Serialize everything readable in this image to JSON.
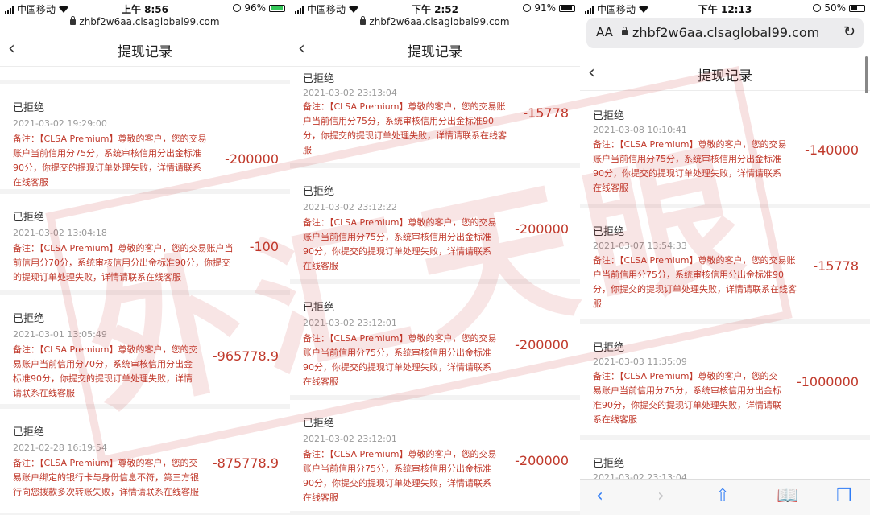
{
  "panels": [
    {
      "status": {
        "carrier": "中国移动",
        "time": "上午 8:56",
        "battery": "96%"
      },
      "url": "zhbf2w6aa.clsaglobal99.com",
      "title": "提现记录",
      "records": [
        {
          "status": "已拒绝",
          "date": "2021-03-02 19:29:00",
          "note": [
            "备注：【CLSA Premium】尊敬的客户，您的交易",
            "账户当前信用分75分，系统审核信用分出金标准",
            "90分，你提交的提现订单处理失败，详情请联系",
            "在线客服"
          ],
          "amount": "-200000"
        },
        {
          "status": "已拒绝",
          "date": "2021-03-02 13:04:18",
          "note": [
            "备注：【CLSA Premium】尊敬的客户，您的交易账户当",
            "前信用分70分，系统审核信用分出金标准90分，你提交",
            "的提现订单处理失败，详情请联系在线客服"
          ],
          "amount": "-100"
        },
        {
          "status": "已拒绝",
          "date": "2021-03-01 13:05:49",
          "note": [
            "备注：【CLSA Premium】尊敬的客户，您的交",
            "易账户当前信用分70分，系统审核信用分出金",
            "标准90分，你提交的提现订单处理失败，详情",
            "请联系在线客服"
          ],
          "amount": "-965778.9"
        },
        {
          "status": "已拒绝",
          "date": "2021-02-28 16:19:54",
          "note": [
            "备注：【CLSA Premium】尊敬的客户，您的交",
            "易账户绑定的银行卡与身份信息不符，第三方银",
            "行向您拨款多次转账失败，详情请联系在线客服"
          ],
          "amount": "-875778.9"
        }
      ]
    },
    {
      "status": {
        "carrier": "中国移动",
        "time": "下午 2:52",
        "battery": "91%"
      },
      "url": "zhbf2w6aa.clsaglobal99.com",
      "title": "提现记录",
      "records": [
        {
          "status": "已拒绝",
          "date": "2021-03-02 23:13:04",
          "note": [
            "备注：【CLSA Premium】尊敬的客户，您的交易账",
            "户当前信用分75分，系统审核信用分出金标准90",
            "分，你提交的提现订单处理失败，详情请联系在线客",
            "服"
          ],
          "amount": "-15778"
        },
        {
          "status": "已拒绝",
          "date": "2021-03-02 23:12:22",
          "note": [
            "备注：【CLSA Premium】尊敬的客户，您的交易",
            "账户当前信用分75分，系统审核信用分出金标准",
            "90分，你提交的提现订单处理失败，详情请联系",
            "在线客服"
          ],
          "amount": "-200000"
        },
        {
          "status": "已拒绝",
          "date": "2021-03-02 23:12:01",
          "note": [
            "备注：【CLSA Premium】尊敬的客户，您的交易",
            "账户当前信用分75分，系统审核信用分出金标准",
            "90分，你提交的提现订单处理失败，详情请联系",
            "在线客服"
          ],
          "amount": "-200000"
        },
        {
          "status": "已拒绝",
          "date": "2021-03-02 23:12:01",
          "note": [
            "备注：【CLSA Premium】尊敬的客户，您的交易",
            "账户当前信用分75分，系统审核信用分出金标准",
            "90分，你提交的提现订单处理失败，详情请联系",
            "在线客服"
          ],
          "amount": "-200000"
        }
      ]
    },
    {
      "status": {
        "carrier": "中国移动",
        "time": "下午 12:13",
        "battery": "50%"
      },
      "url": "zhbf2w6aa.clsaglobal99.com",
      "url_aa": "AA",
      "title": "提现记录",
      "records": [
        {
          "status": "已拒绝",
          "date": "2021-03-08 10:10:41",
          "note": [
            "备注：【CLSA Premium】尊敬的客户，您的交易",
            "账户当前信用分75分，系统审核信用分出金标准",
            "90分，你提交的提现订单处理失败，详情请联系",
            "在线客服"
          ],
          "amount": "-140000"
        },
        {
          "status": "已拒绝",
          "date": "2021-03-07 13:54:33",
          "note": [
            "备注：【CLSA Premium】尊敬的客户，您的交易账",
            "户当前信用分75分，系统审核信用分出金标准90",
            "分，你提交的提现订单处理失败，详情请联系在线客",
            "服"
          ],
          "amount": "-15778"
        },
        {
          "status": "已拒绝",
          "date": "2021-03-03 11:35:09",
          "note": [
            "备注：【CLSA Premium】尊敬的客户，您的交",
            "易账户当前信用分75分，系统审核信用分出金标",
            "准90分，你提交的提现订单处理失败，详情请联",
            "系在线客服"
          ],
          "amount": "-1000000"
        },
        {
          "status": "已拒绝",
          "date": "2021-03-02 23:13:04",
          "note": [],
          "amount": ""
        }
      ]
    }
  ],
  "watermark": "外汇天眼",
  "colors": {
    "accent_red": "#c0392b",
    "safari_blue": "#2f7cf6"
  }
}
